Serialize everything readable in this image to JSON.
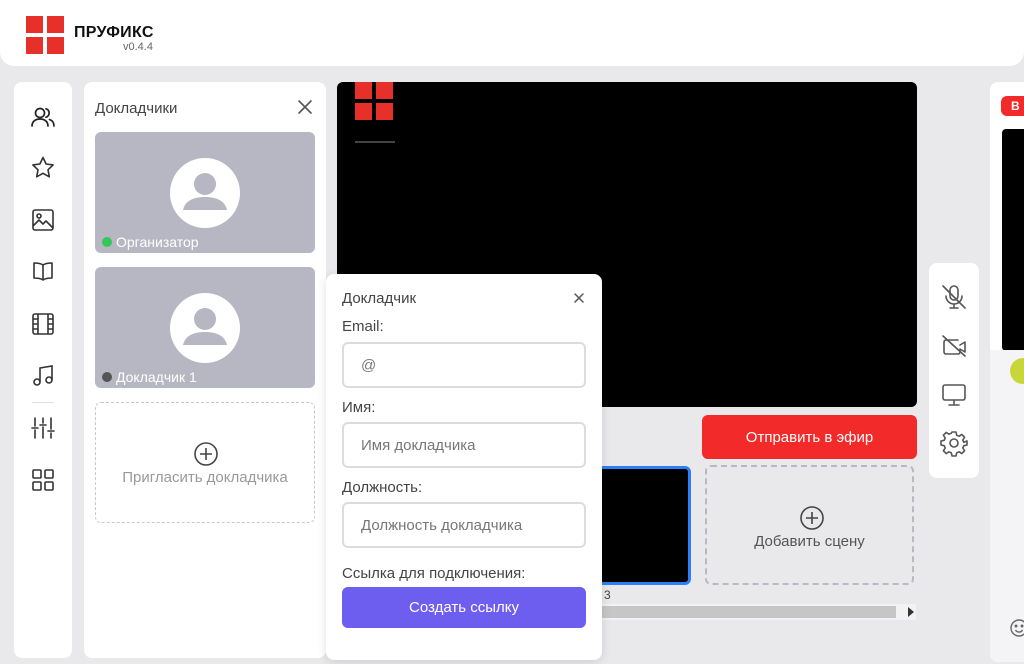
{
  "app": {
    "brand": "ПРУФИКС",
    "version": "v0.4.4"
  },
  "sidebar": {
    "icons": [
      "people-icon",
      "star-icon",
      "image-icon",
      "book-icon",
      "film-icon",
      "music-icon",
      "sliders-icon",
      "grid-icon"
    ]
  },
  "speakers_panel": {
    "title": "Докладчики",
    "cards": [
      {
        "name": "Организатор",
        "status_color": "#34c759"
      },
      {
        "name": "Докладчик 1",
        "status_color": "#555555"
      }
    ],
    "invite_label": "Пригласить докладчика"
  },
  "stage": {
    "live_button": "Отправить в эфир",
    "scene_number": "3",
    "add_scene_label": "Добавить сцену"
  },
  "controls": {
    "icons": [
      "mic-off-icon",
      "camera-off-icon",
      "screen-share-icon",
      "settings-icon"
    ]
  },
  "right_panel": {
    "badge_text": "В"
  },
  "dialog": {
    "title": "Докладчик",
    "email_label": "Email:",
    "email_placeholder": "@",
    "name_label": "Имя:",
    "name_placeholder": "Имя докладчика",
    "position_label": "Должность:",
    "position_placeholder": "Должность докладчика",
    "link_label": "Ссылка для подключения:",
    "create_link_button": "Создать ссылку"
  },
  "colors": {
    "brand_red": "#e8302a",
    "live_red": "#f22a2a",
    "accent_purple": "#6d5ef0",
    "selection_blue": "#2d7ff9"
  }
}
